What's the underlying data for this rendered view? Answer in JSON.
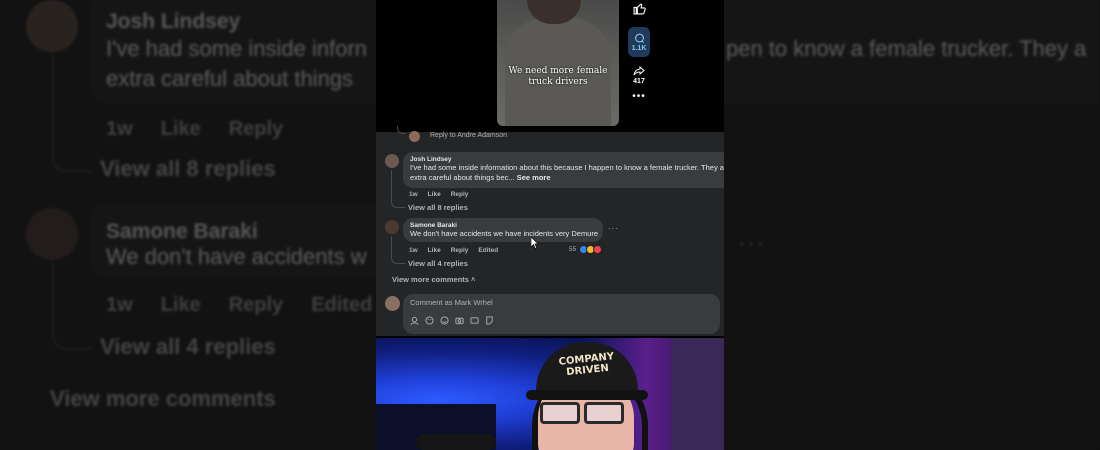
{
  "video": {
    "caption": "We need more female truck drivers",
    "comment_count": "1.1K",
    "share_count": "417"
  },
  "panel": {
    "reply_to": "Reply to Andre Adamson",
    "comments": [
      {
        "name": "Josh Lindsey",
        "text_line1": "I've had some inside information about this because I happen to know a female trucker. They a",
        "text_line2": "extra careful about things bec...",
        "see_more": "See more",
        "time": "1w",
        "like": "Like",
        "reply": "Reply",
        "view_replies": "View all 8 replies"
      },
      {
        "name": "Samone Baraki",
        "text": "We don't have accidents we have incidents very Demure",
        "time": "1w",
        "like": "Like",
        "reply": "Reply",
        "edited": "Edited",
        "reaction_count": "55",
        "view_replies": "View all 4 replies"
      }
    ],
    "view_more": "View more comments",
    "composer_placeholder": "Comment as Mark Wrhel"
  },
  "cam": {
    "cap_text_line1": "COMPANY",
    "cap_text_line2": "DRIVEN"
  },
  "background": {
    "name1": "Josh Lindsey",
    "text1_a": "I've had some inside inforn",
    "text1_b": "pen to know a female trucker. They a",
    "text1_c": "extra careful about things",
    "time": "1w",
    "like": "Like",
    "reply": "Reply",
    "view_replies1": "View all 8 replies",
    "name2": "Samone Baraki",
    "text2": "We don't have accidents w",
    "edited": "Edited",
    "view_replies2": "View all 4 replies",
    "view_more": "View more comments"
  },
  "colors": {
    "panel_bg": "#242526",
    "bubble_bg": "#3a3b3c",
    "accent_blue": "#8fc3ff"
  }
}
